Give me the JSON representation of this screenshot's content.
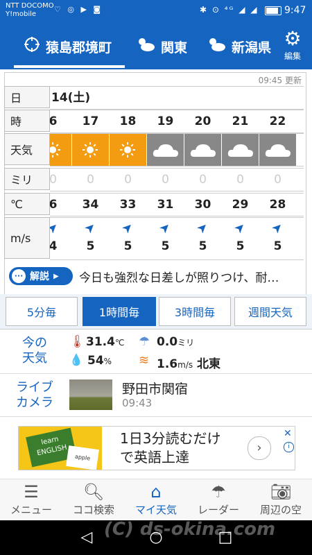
{
  "status_bar": {
    "carrier_line1": "NTT DOCOMO",
    "carrier_line2": "Y!mobile",
    "notification_icons": "♡ ◎ ▶ ◙",
    "system_icons": "✱ ⊙ ⁴ᴳ ◢ ◢",
    "battery": "",
    "time": "9:47"
  },
  "header": {
    "locations": [
      "猿島郡境町",
      "関東",
      "新潟県"
    ],
    "edit_label": "編集"
  },
  "forecast": {
    "updated": "09:45 更新",
    "row_labels": {
      "day": "日",
      "hour": "時",
      "weather": "天気",
      "rain": "ミリ",
      "temp": "℃",
      "wind": "m/s"
    },
    "date": "14(土)",
    "hours": [
      "6",
      "17",
      "18",
      "19",
      "20",
      "21",
      "22"
    ],
    "weather": [
      "sun",
      "sun",
      "sun",
      "cloud",
      "cloud",
      "cloud",
      "cloud"
    ],
    "rain": [
      "0",
      "0",
      "0",
      "0",
      "0",
      "0",
      "0"
    ],
    "temps": [
      "6",
      "34",
      "33",
      "31",
      "30",
      "29",
      "28"
    ],
    "wind": [
      "4",
      "5",
      "5",
      "5",
      "5",
      "5",
      "5"
    ],
    "explain_label": "解説",
    "explain_text": "今日も強烈な日差しが照りつけ、耐…"
  },
  "interval_tabs": [
    "5分毎",
    "1時間毎",
    "3時間毎",
    "週間天気"
  ],
  "now": {
    "label": "今の\n天気",
    "temp_value": "31.4",
    "temp_unit": "℃",
    "rain_value": "0.0",
    "rain_unit": "ミリ",
    "humidity_value": "54",
    "humidity_unit": "%",
    "wind_value": "1.6",
    "wind_unit": "m/s",
    "wind_dir": "北東"
  },
  "live_camera": {
    "label": "ライブ\nカメラ",
    "name": "野田市関宿",
    "time": "09:43"
  },
  "ad": {
    "line1": "1日3分読むだけ",
    "line2": "で英語上達",
    "book_text": "learn ENGLISH",
    "note_text": "apple"
  },
  "bottom_nav": [
    "メニュー",
    "ココ検索",
    "マイ天気",
    "レーダー",
    "周辺の空"
  ],
  "watermark": "(C) ds-okina.com",
  "colors": {
    "brand": "#1565C0",
    "sun": "#F39C12",
    "cloud": "#888888"
  }
}
